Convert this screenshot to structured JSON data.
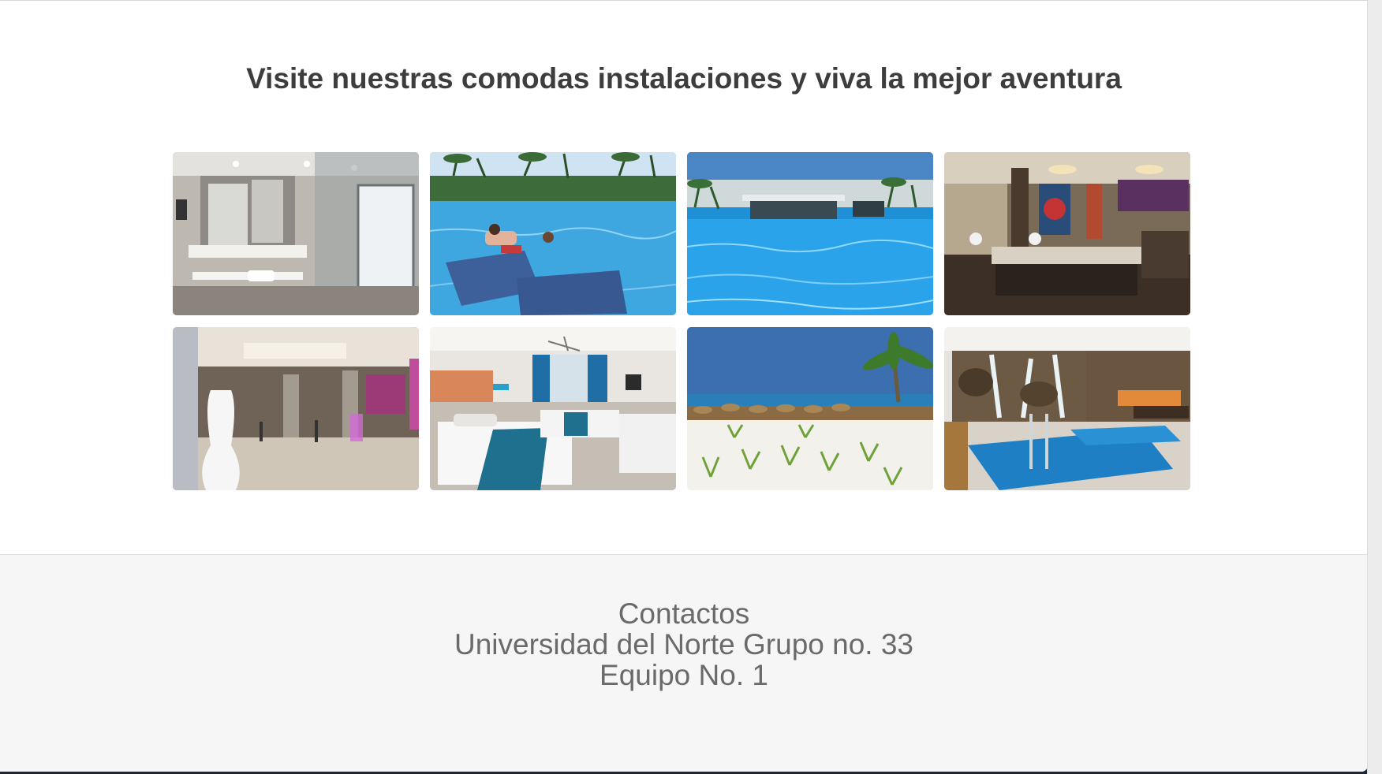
{
  "gallery": {
    "title": "Visite nuestras comodas instalaciones y viva la mejor aventura",
    "photos": [
      {
        "subject": "bathroom"
      },
      {
        "subject": "pool-loungers"
      },
      {
        "subject": "pool"
      },
      {
        "subject": "buffet-restaurant"
      },
      {
        "subject": "lobby"
      },
      {
        "subject": "bedroom"
      },
      {
        "subject": "beach"
      },
      {
        "subject": "spa-pool"
      }
    ]
  },
  "footer": {
    "heading": "Contactos",
    "line1": "Universidad del Norte Grupo no. 33",
    "line2": "Equipo No. 1"
  },
  "colors": {
    "title_text": "#3d3d3d",
    "footer_text": "#6a6a6a",
    "footer_bg": "#f6f6f6",
    "backdrop": "#1f2735"
  }
}
